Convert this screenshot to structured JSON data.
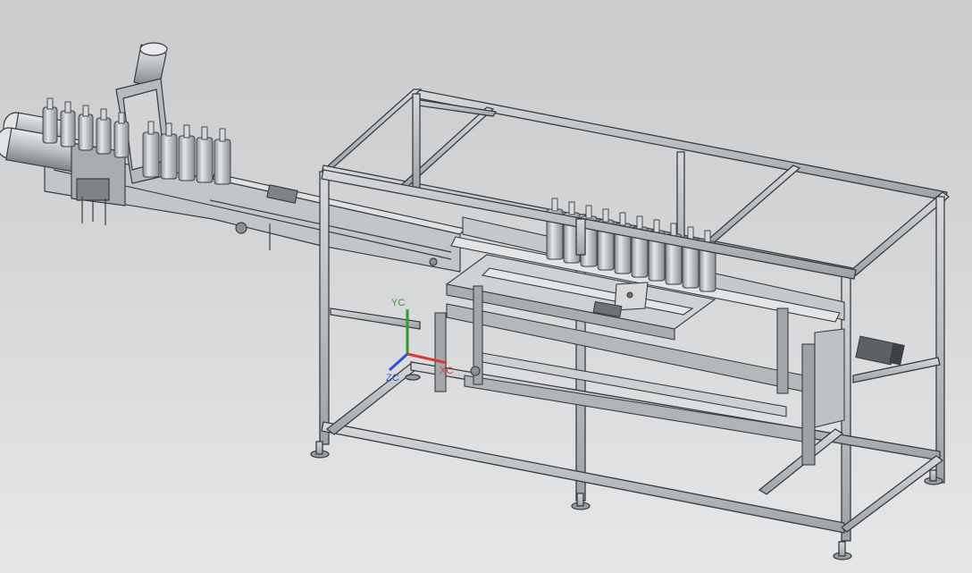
{
  "viewport": {
    "background_top": "#c9cbcd",
    "background_bottom": "#e6e7e8"
  },
  "model": {
    "name": "",
    "bottle_count_left_row1": 5,
    "bottle_count_left_row2": 5,
    "bottle_count_center": 10
  },
  "triad": {
    "y_label": "YC",
    "x_label": "XC",
    "z_label": "ZC",
    "y_color": "#2e9a2e",
    "x_color": "#d83a3a",
    "z_color": "#2f4fd8"
  },
  "colors": {
    "frame": "#b9bcbf",
    "frame_edge": "#3a3d40",
    "metal_light": "#c8cbce",
    "metal_dark": "#8d9196",
    "bottle": "#c9cccf"
  }
}
